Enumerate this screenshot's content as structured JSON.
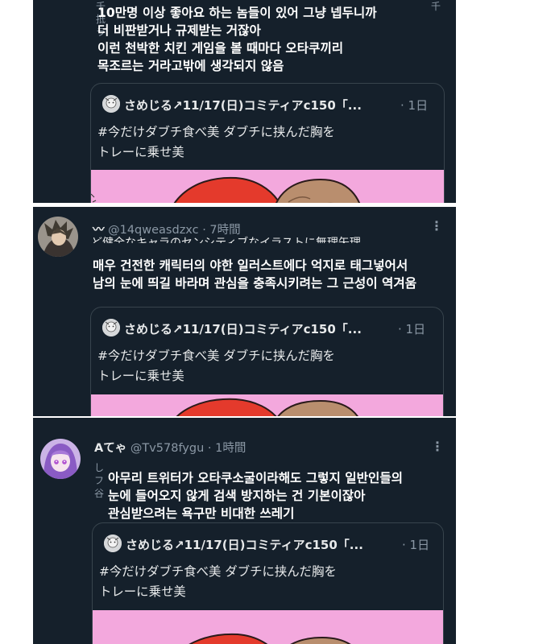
{
  "quoted": {
    "author": "さめじる↗11/17(日)コミティアc150「...",
    "time": "· 1日",
    "text_line1": "#今だけダブチ食べ美  ダブチに挟んだ胸を",
    "text_line2": "トレーに乗せ美"
  },
  "tweets": [
    {
      "body": [
        "10만명 이상 좋아요 하는 놈들이 있어 그냥 넵두니까",
        "더 비판받거나 규제받는 거잖아",
        "이런 천박한 치킨 게임을 볼 때마다 오타쿠끼리",
        "목조르는 거라고밖에 생각되지 않음"
      ],
      "side_text": "千\n抵\nラ",
      "side_right": "千\n"
    },
    {
      "display_name": "〰",
      "handle": "@14qweasdzxc",
      "time": "· 7時間",
      "more": "⋮",
      "partial_jp": "ど健全なキャラのセンシティブなイラストに無理矢理",
      "body": [
        "매우 건전한 캐릭터의 야한 일러스트에다 억지로 태그넣어서",
        "남의 눈에 띄길 바라며 관심을 충족시키려는 그 근성이 역겨움"
      ]
    },
    {
      "display_name": "Aてゃ",
      "handle": "@Tv578fygu",
      "time": "· 1時間",
      "more": "⋮",
      "side_text": "し\nフ\n谷",
      "body": [
        "아무리 트위터가 오타쿠소굴이라해도 그렇지 일반인들의",
        "눈에 들어오지 않게 검색 방지하는 건 기본이잖아",
        "관심받으려는 욕구만 비대한 쓰레기"
      ]
    }
  ],
  "colors": {
    "bg": "#15202b",
    "border": "#38444d",
    "muted": "#8b98a5",
    "image_pink": "#f3a8dd"
  }
}
